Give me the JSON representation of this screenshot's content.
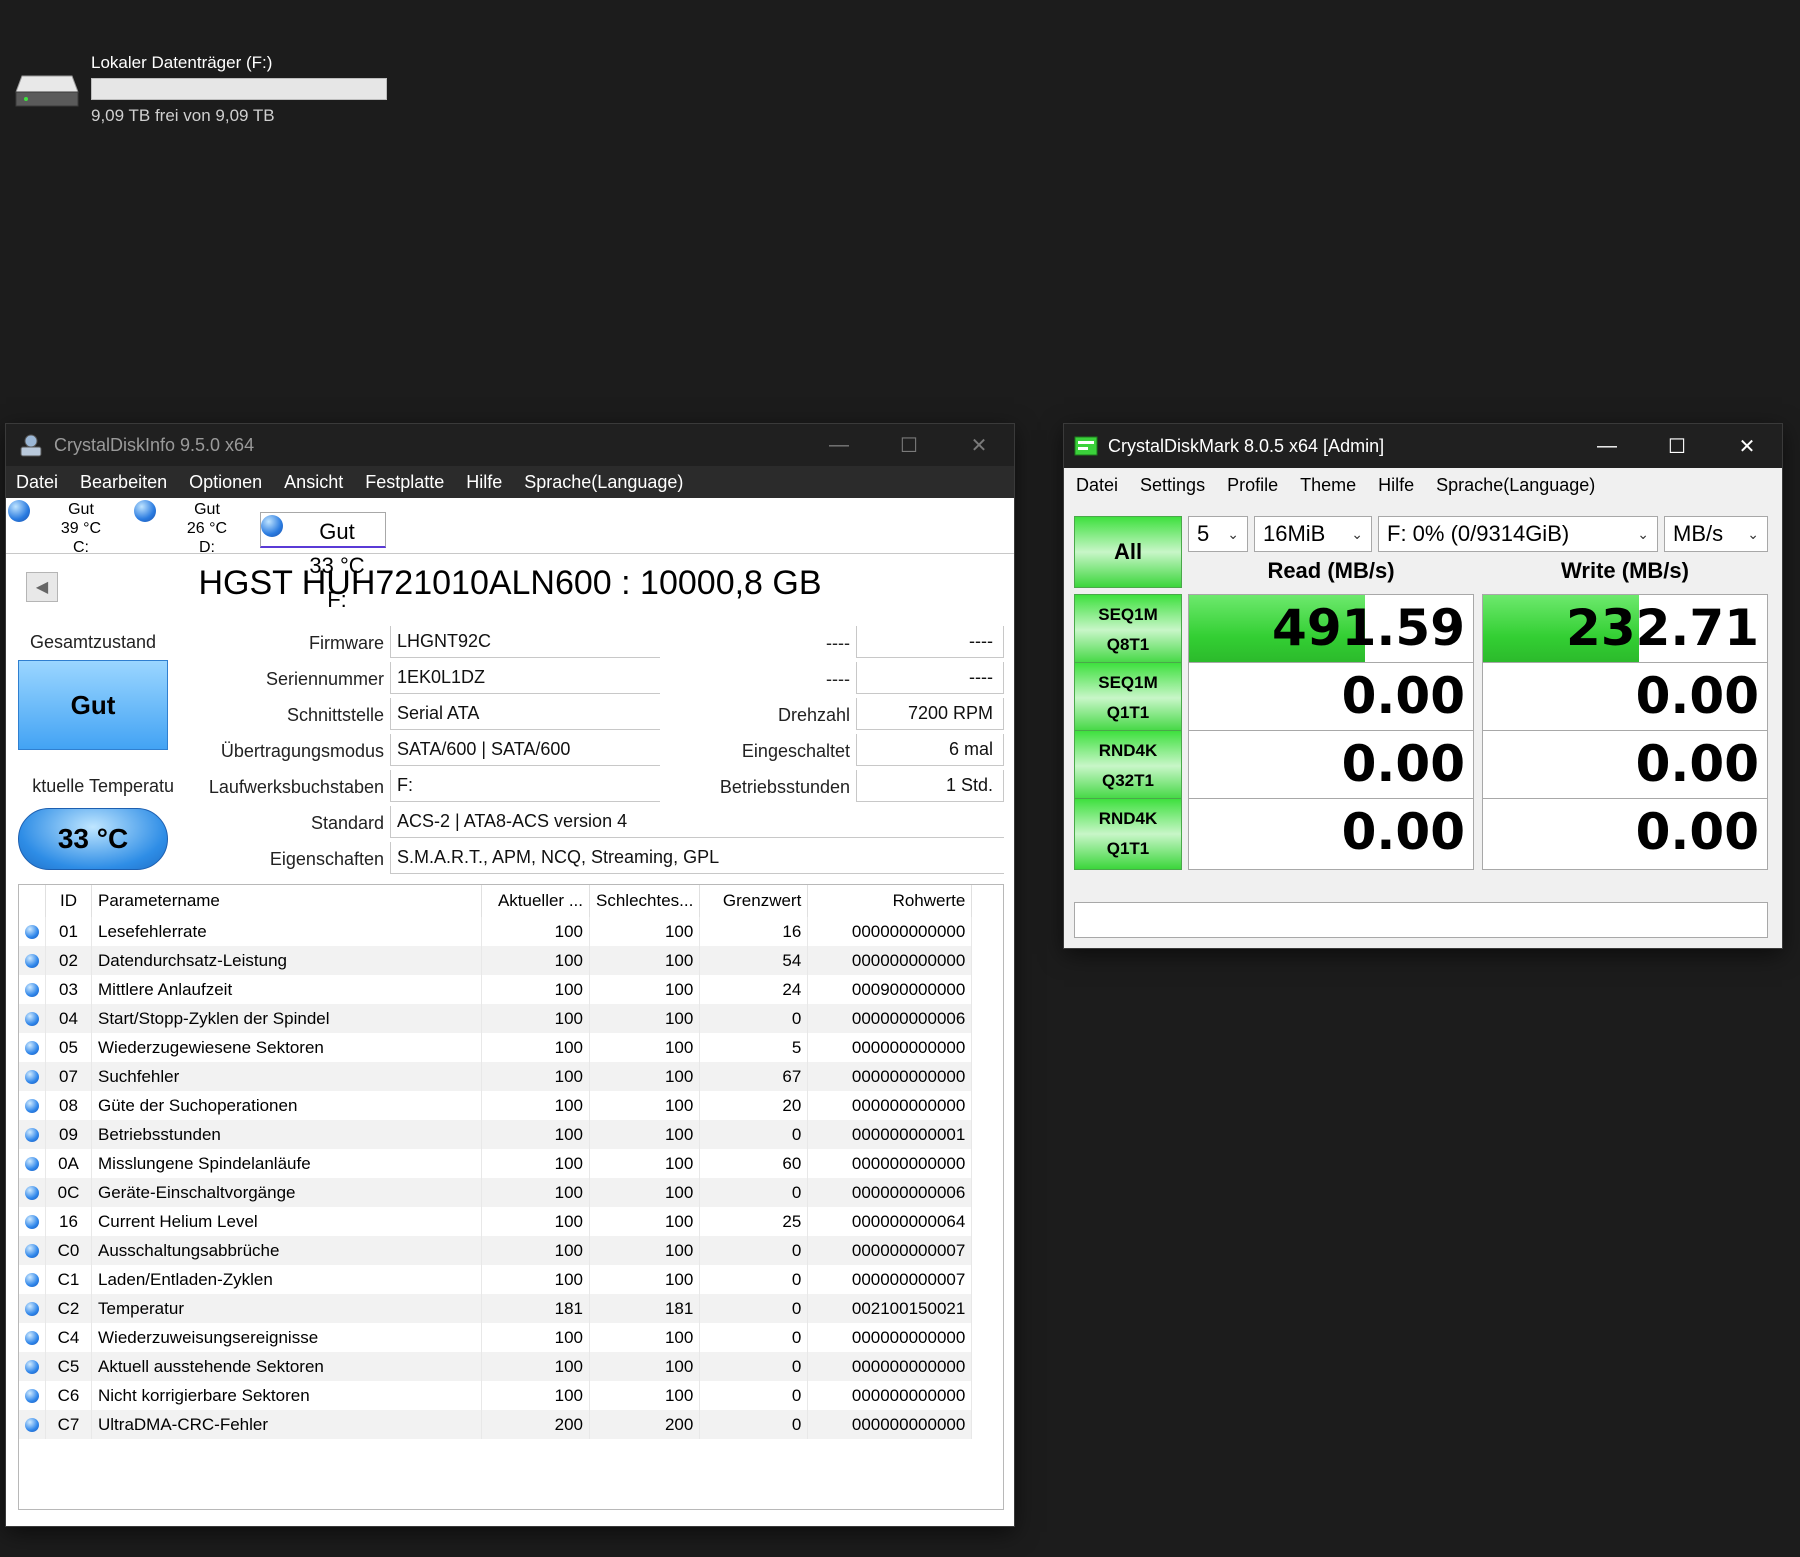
{
  "drive": {
    "name": "Lokaler Datenträger (F:)",
    "free_text": "9,09 TB frei von 9,09 TB",
    "used_fraction": 0.0
  },
  "cdi": {
    "title": "CrystalDiskInfo 9.5.0 x64",
    "menu": [
      "Datei",
      "Bearbeiten",
      "Optionen",
      "Ansicht",
      "Festplatte",
      "Hilfe",
      "Sprache(Language)"
    ],
    "disks": [
      {
        "status": "Gut",
        "temp": "39 °C",
        "letter": "C:"
      },
      {
        "status": "Gut",
        "temp": "26 °C",
        "letter": "D:"
      },
      {
        "status": "Gut",
        "temp": "33 °C",
        "letter": "F:"
      }
    ],
    "model": "HGST HUH721010ALN600 : 10000,8 GB",
    "labels": {
      "gesamtzustand": "Gesamtzustand",
      "aktuelle_temp": "ktuelle Temperatu",
      "firmware": "Firmware",
      "seriennummer": "Seriennummer",
      "schnittstelle": "Schnittstelle",
      "uebertragungsmodus": "Übertragungsmodus",
      "laufwerksbuchstaben": "Laufwerksbuchstaben",
      "standard": "Standard",
      "eigenschaften": "Eigenschaften",
      "blank1": "----",
      "blank2": "----",
      "drehzahl": "Drehzahl",
      "eingeschaltet": "Eingeschaltet",
      "betriebsstunden": "Betriebsstunden"
    },
    "values": {
      "health": "Gut",
      "temp": "33 °C",
      "firmware": "LHGNT92C",
      "seriennummer": "1EK0L1DZ",
      "schnittstelle": "Serial ATA",
      "uebertragungsmodus": "SATA/600 | SATA/600",
      "laufwerksbuchstaben": "F:",
      "standard": "ACS-2 | ATA8-ACS version 4",
      "eigenschaften": "S.M.A.R.T., APM, NCQ, Streaming, GPL",
      "blank1": "----",
      "blank2": "----",
      "drehzahl": "7200 RPM",
      "eingeschaltet": "6 mal",
      "betriebsstunden": "1 Std."
    },
    "smart_headers": [
      "ID",
      "Parametername",
      "Aktueller ...",
      "Schlechtes...",
      "Grenzwert",
      "Rohwerte"
    ],
    "smart_rows": [
      [
        "01",
        "Lesefehlerrate",
        "100",
        "100",
        "16",
        "000000000000"
      ],
      [
        "02",
        "Datendurchsatz-Leistung",
        "100",
        "100",
        "54",
        "000000000000"
      ],
      [
        "03",
        "Mittlere Anlaufzeit",
        "100",
        "100",
        "24",
        "000900000000"
      ],
      [
        "04",
        "Start/Stopp-Zyklen der Spindel",
        "100",
        "100",
        "0",
        "000000000006"
      ],
      [
        "05",
        "Wiederzugewiesene Sektoren",
        "100",
        "100",
        "5",
        "000000000000"
      ],
      [
        "07",
        "Suchfehler",
        "100",
        "100",
        "67",
        "000000000000"
      ],
      [
        "08",
        "Güte der Suchoperationen",
        "100",
        "100",
        "20",
        "000000000000"
      ],
      [
        "09",
        "Betriebsstunden",
        "100",
        "100",
        "0",
        "000000000001"
      ],
      [
        "0A",
        "Misslungene Spindelanläufe",
        "100",
        "100",
        "60",
        "000000000000"
      ],
      [
        "0C",
        "Geräte-Einschaltvorgänge",
        "100",
        "100",
        "0",
        "000000000006"
      ],
      [
        "16",
        "Current Helium Level",
        "100",
        "100",
        "25",
        "000000000064"
      ],
      [
        "C0",
        "Ausschaltungsabbrüche",
        "100",
        "100",
        "0",
        "000000000007"
      ],
      [
        "C1",
        "Laden/Entladen-Zyklen",
        "100",
        "100",
        "0",
        "000000000007"
      ],
      [
        "C2",
        "Temperatur",
        "181",
        "181",
        "0",
        "002100150021"
      ],
      [
        "C4",
        "Wiederzuweisungsereignisse",
        "100",
        "100",
        "0",
        "000000000000"
      ],
      [
        "C5",
        "Aktuell ausstehende Sektoren",
        "100",
        "100",
        "0",
        "000000000000"
      ],
      [
        "C6",
        "Nicht korrigierbare Sektoren",
        "100",
        "100",
        "0",
        "000000000000"
      ],
      [
        "C7",
        "UltraDMA-CRC-Fehler",
        "200",
        "200",
        "0",
        "000000000000"
      ]
    ]
  },
  "cdm": {
    "title": "CrystalDiskMark 8.0.5 x64 [Admin]",
    "menu": [
      "Datei",
      "Settings",
      "Profile",
      "Theme",
      "Hilfe",
      "Sprache(Language)"
    ],
    "all_label": "All",
    "count": "5",
    "size": "16MiB",
    "drive": "F: 0% (0/9314GiB)",
    "unit": "MB/s",
    "read_header": "Read (MB/s)",
    "write_header": "Write (MB/s)",
    "tests": [
      {
        "line1": "SEQ1M",
        "line2": "Q8T1",
        "read": "491.59",
        "write": "232.71",
        "read_fill": 0.62,
        "write_fill": 0.55
      },
      {
        "line1": "SEQ1M",
        "line2": "Q1T1",
        "read": "0.00",
        "write": "0.00",
        "read_fill": 0,
        "write_fill": 0
      },
      {
        "line1": "RND4K",
        "line2": "Q32T1",
        "read": "0.00",
        "write": "0.00",
        "read_fill": 0,
        "write_fill": 0
      },
      {
        "line1": "RND4K",
        "line2": "Q1T1",
        "read": "0.00",
        "write": "0.00",
        "read_fill": 0,
        "write_fill": 0
      }
    ],
    "colors": {
      "green": "#33cf33"
    }
  }
}
